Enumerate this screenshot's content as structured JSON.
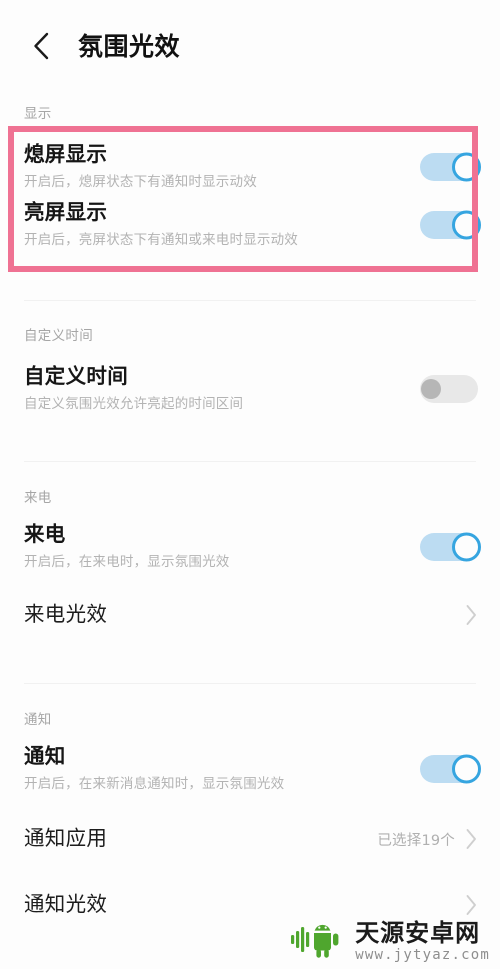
{
  "header": {
    "back_icon": "chevron-left-icon",
    "title": "氛围光效"
  },
  "sections": [
    {
      "label": "显示",
      "rows": [
        {
          "title": "熄屏显示",
          "subtitle": "开启后，熄屏状态下有通知时显示动效",
          "control": "toggle",
          "state": "on"
        },
        {
          "title": "亮屏显示",
          "subtitle": "开启后，亮屏状态下有通知或来电时显示动效",
          "control": "toggle",
          "state": "on"
        }
      ]
    },
    {
      "label": "自定义时间",
      "rows": [
        {
          "title": "自定义时间",
          "subtitle": "自定义氛围光效允许亮起的时间区间",
          "control": "toggle",
          "state": "off"
        }
      ]
    },
    {
      "label": "来电",
      "rows": [
        {
          "title": "来电",
          "subtitle": "开启后，在来电时，显示氛围光效",
          "control": "toggle",
          "state": "on"
        },
        {
          "title": "来电光效",
          "subtitle": "",
          "control": "chevron",
          "value": ""
        }
      ]
    },
    {
      "label": "通知",
      "rows": [
        {
          "title": "通知",
          "subtitle": "开启后，在来新消息通知时，显示氛围光效",
          "control": "toggle",
          "state": "on"
        },
        {
          "title": "通知应用",
          "subtitle": "",
          "control": "chevron",
          "value": "已选择19个"
        },
        {
          "title": "通知光效",
          "subtitle": "",
          "control": "chevron",
          "value": ""
        }
      ]
    }
  ],
  "highlight": {
    "color": "#ef7293",
    "note": "显示 分组高亮框"
  },
  "watermark": {
    "site_name": "天源安卓网",
    "url": "www.jytyaz.com",
    "logo_color": "#4fa62e"
  },
  "colors": {
    "toggle_on_track": "#bcdcf2",
    "toggle_on_ring": "#36a5e0",
    "toggle_off_track": "#e8e8e8",
    "toggle_off_knob": "#b6b6b6",
    "title_text": "#161616",
    "subtitle_text": "#b3b3b3",
    "section_label": "#a6a6a6",
    "background": "#fdfdfd",
    "divider": "#f1f1f1"
  }
}
